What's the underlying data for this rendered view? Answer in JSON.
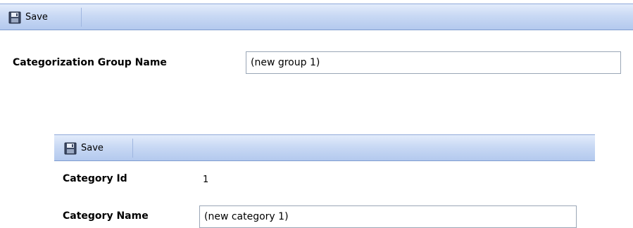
{
  "group_form": {
    "toolbar": {
      "save_label": "Save"
    },
    "name_label": "Categorization Group Name",
    "name_value": "(new group 1)"
  },
  "category_form": {
    "toolbar": {
      "save_label": "Save"
    },
    "id_label": "Category Id",
    "id_value": "1",
    "name_label": "Category Name",
    "name_value": "(new category 1)"
  }
}
